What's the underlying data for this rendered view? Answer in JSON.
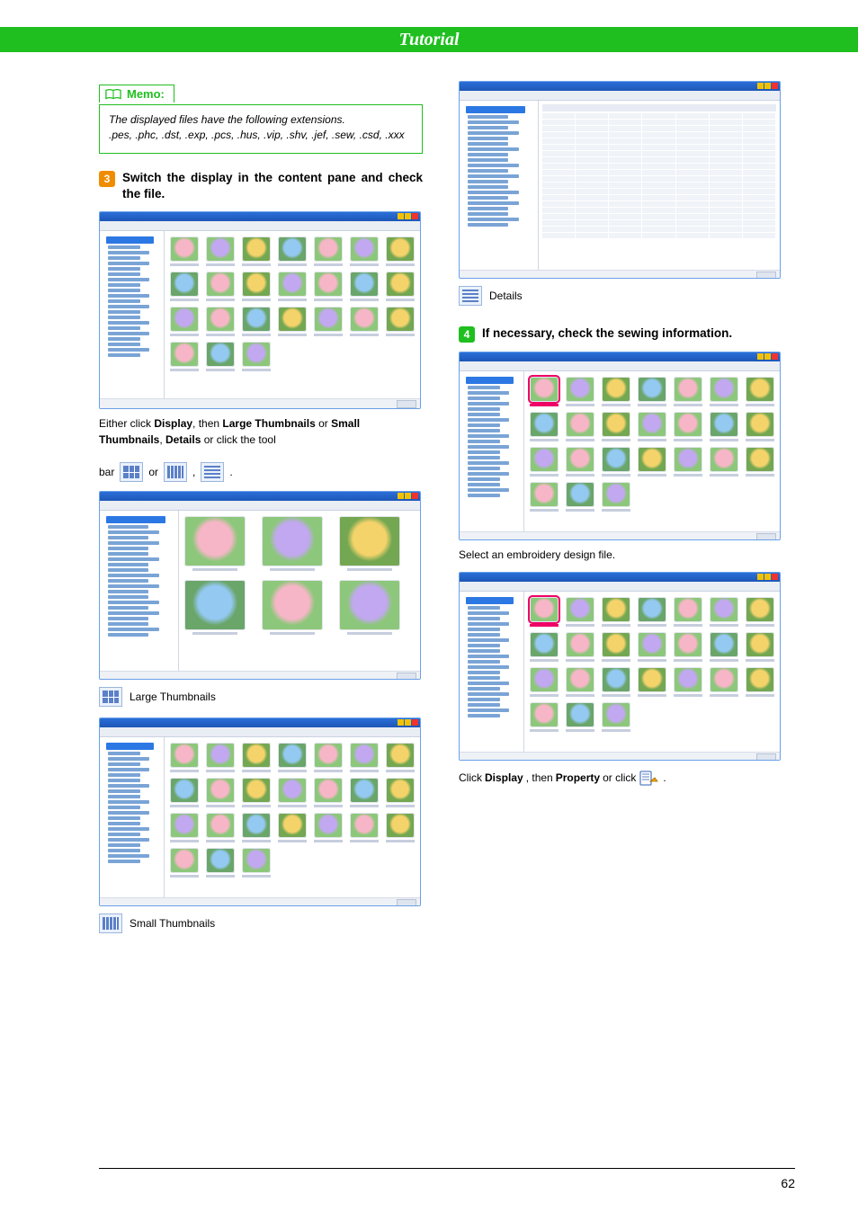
{
  "page_title": "Tutorial",
  "memo": {
    "title": "Memo:",
    "body_line1": "The displayed files have the following extensions.",
    "body_line2": ".pes, .phc, .dst, .exp, .pcs, .hus, .vip, .shv, .jef, .sew, .csd, .xxx"
  },
  "steps": {
    "s3": {
      "num": "3",
      "text": "Switch the display in the content pane and check the file."
    },
    "s4": {
      "num": "4",
      "text": "If necessary, check the sewing information."
    }
  },
  "body": {
    "either_click": "Either click ",
    "display_bold": "Display",
    "then": ", then ",
    "large_thumbs_bold": "Large Thumbnails",
    "or_word": " or ",
    "small_thumbs_bold": "Small Thumbnails",
    "comma_sp": ", ",
    "details_bold": "Details",
    "or_click_tool": " or click the tool",
    "bar_word": "bar ",
    "or_mid": " or ",
    "period": " ."
  },
  "labels": {
    "large_thumbnails": "Large Thumbnails",
    "small_thumbnails": "Small Thumbnails",
    "details": "Details"
  },
  "right": {
    "select_design": "Select an embroidery design file.",
    "click_display": "Click ",
    "display_bold": "Display",
    "then_prop": ", then ",
    "property_bold": "Property",
    "or_click": " or click  ",
    "period": " ."
  },
  "page_number": "62"
}
